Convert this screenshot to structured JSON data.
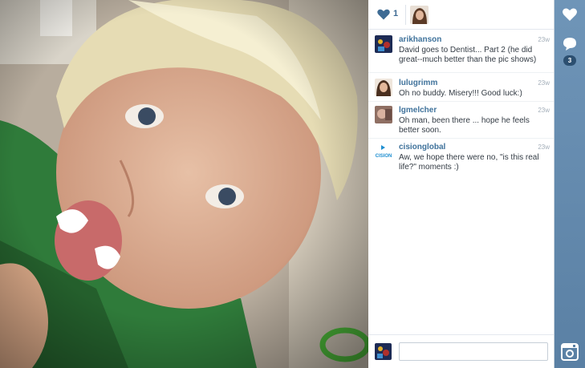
{
  "post": {
    "like_count": "1",
    "comment_badge": "3"
  },
  "comments": [
    {
      "user": "arikhanson",
      "time": "23w",
      "text": "David goes to Dentist... Part 2 (he did great--much better than the pic shows)"
    },
    {
      "user": "lulugrimm",
      "time": "23w",
      "text": "Oh no buddy. Misery!!! Good luck:)"
    },
    {
      "user": "lgmelcher",
      "time": "23w",
      "text": "Oh man, been there ... hope he feels better soon."
    },
    {
      "user": "cisionglobal",
      "time": "23w",
      "text": "Aw, we hope there were no, \"is this real life?\" moments :)"
    }
  ],
  "cision_logo_text": "CISION",
  "colors": {
    "username": "#3f729b",
    "rail": "#6f95b8",
    "badge": "#2c4f70"
  },
  "icons": [
    "heart-icon",
    "like-heart-icon",
    "comment-icon",
    "instagram-icon"
  ]
}
